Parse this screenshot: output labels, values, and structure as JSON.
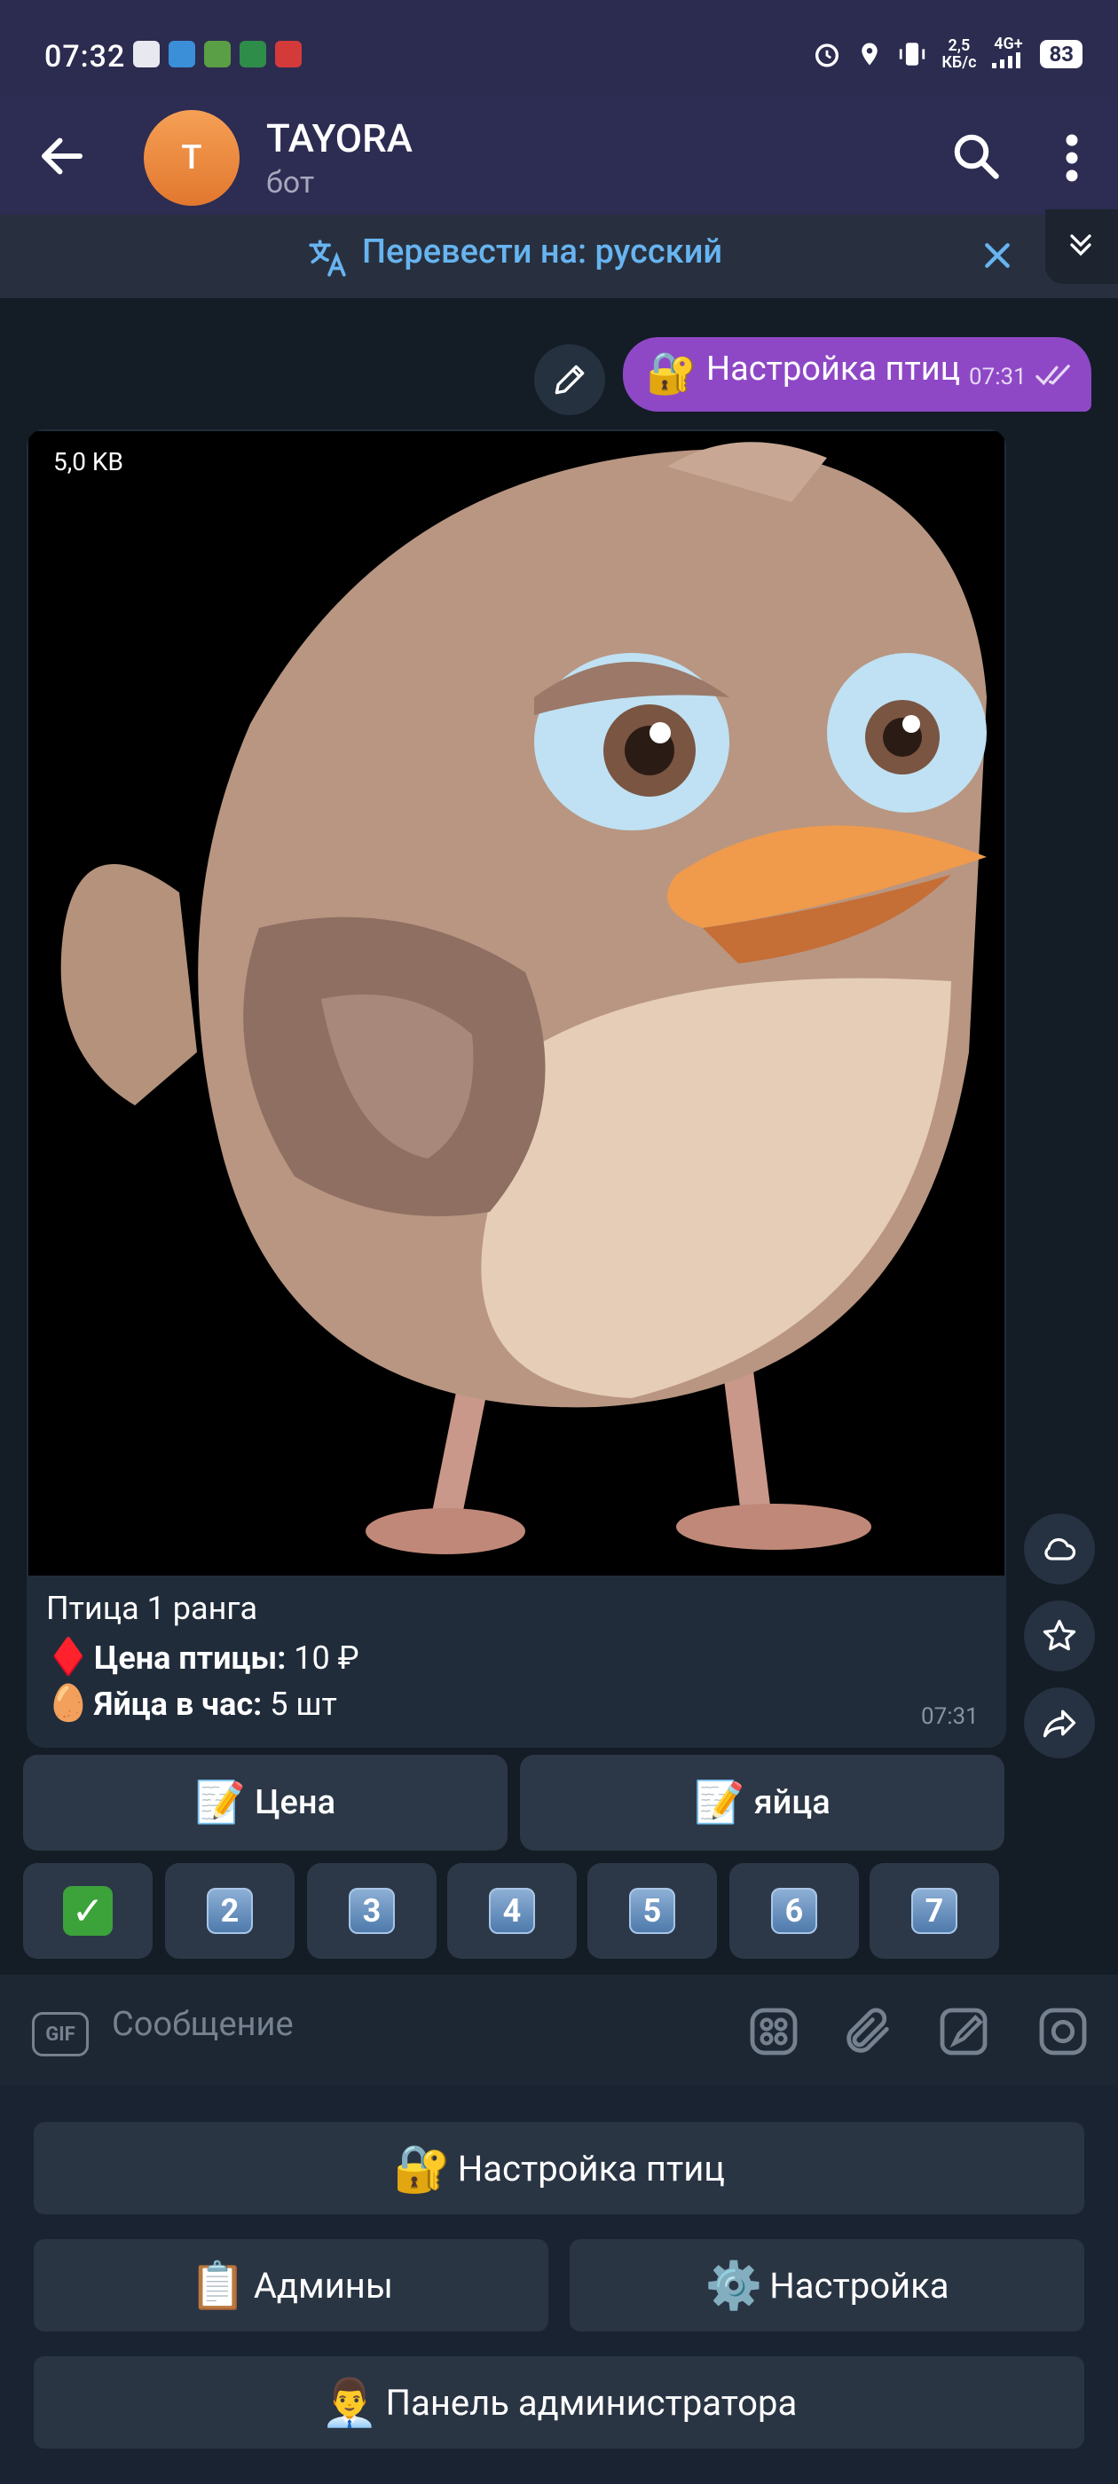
{
  "status_bar": {
    "time": "07:32",
    "speed": "2,5",
    "speed_unit": "КБ/с",
    "network": "4G+",
    "battery": "83"
  },
  "header": {
    "avatar_letter": "T",
    "name": "TAYORA",
    "subtitle": "бот"
  },
  "translate_bar": {
    "text": "Перевести на: русский"
  },
  "outgoing_message": {
    "emoji": "🔐",
    "text": "Настройка птиц",
    "time": "07:31"
  },
  "photo_message": {
    "file_size": "5,0 KB",
    "caption_title": "Птица 1 ранга",
    "price_emoji": "♦️",
    "price_label": "Цена птицы:",
    "price_value": "10 ₽",
    "eggs_emoji": "🥚",
    "eggs_label": "Яйца в час:",
    "eggs_value": "5 шт",
    "time": "07:31"
  },
  "inline_keyboard": {
    "row1": [
      {
        "emoji": "📝",
        "label": "Цена"
      },
      {
        "emoji": "📝",
        "label": "яйца"
      }
    ],
    "row2": [
      "✓",
      "2",
      "3",
      "4",
      "5",
      "6",
      "7"
    ]
  },
  "input": {
    "gif_label": "GIF",
    "placeholder": "Сообщение"
  },
  "reply_keyboard": {
    "row1": [
      {
        "emoji": "🔐",
        "label": "Настройка птиц"
      }
    ],
    "row2": [
      {
        "emoji": "📋",
        "label": "Админы"
      },
      {
        "emoji": "⚙️",
        "label": "Настройка"
      }
    ],
    "row3": [
      {
        "emoji": "👨‍💼",
        "label": "Панель администратора"
      }
    ]
  }
}
